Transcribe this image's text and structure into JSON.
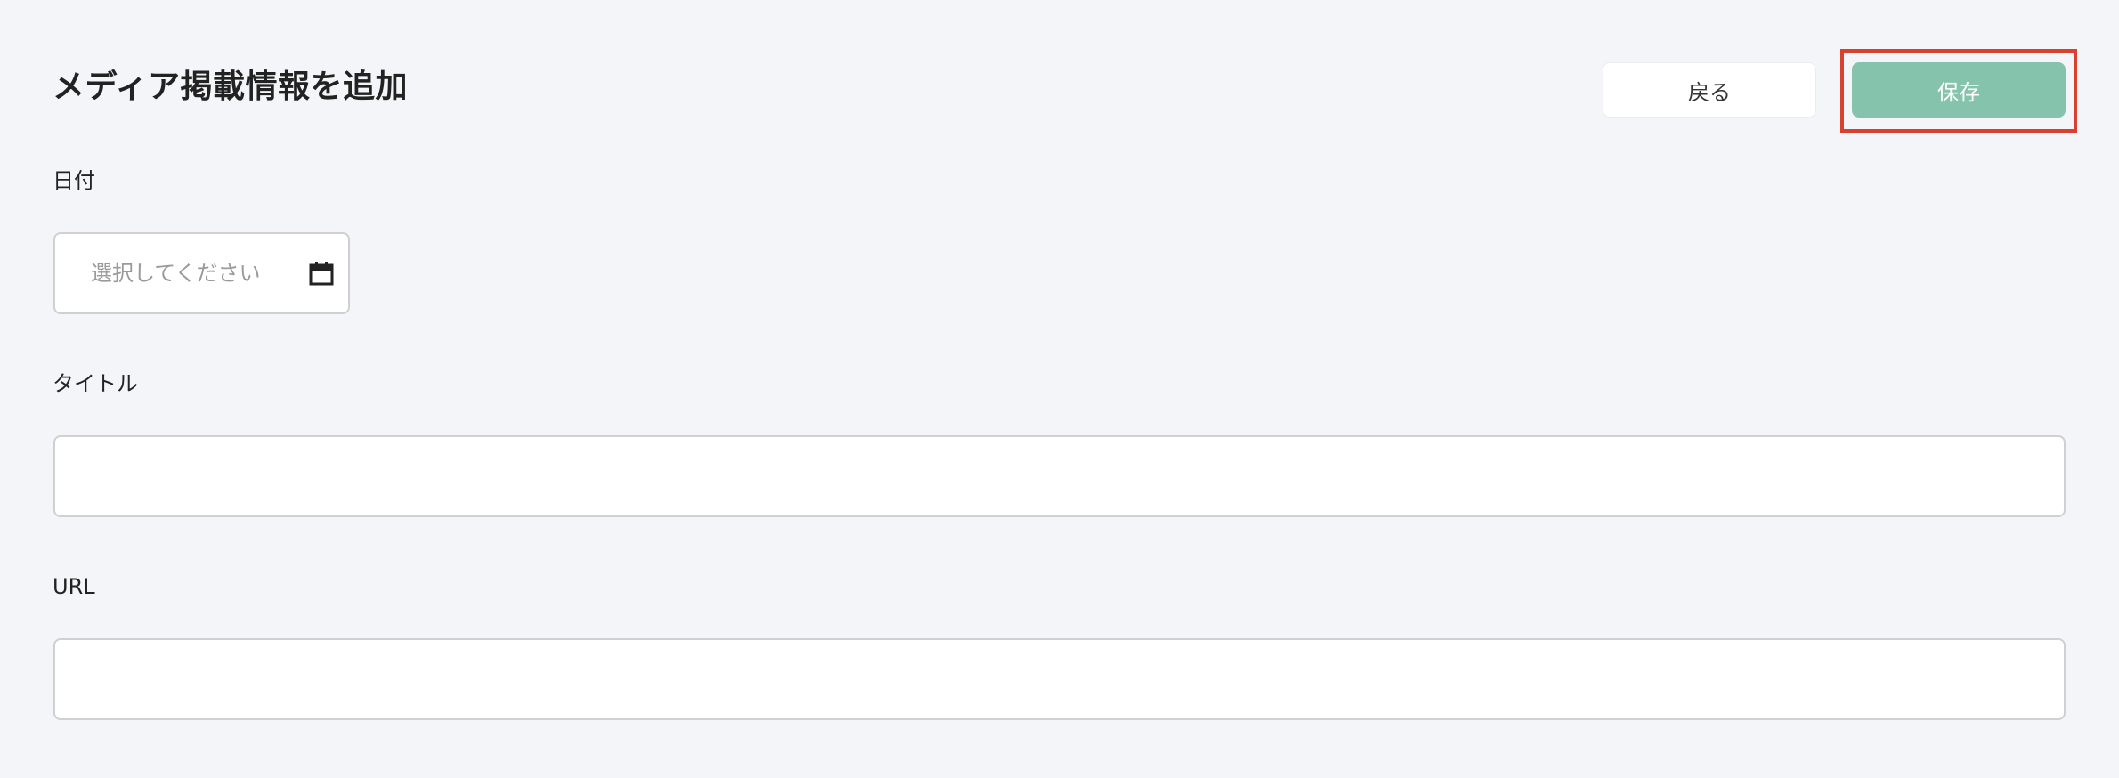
{
  "header": {
    "title": "メディア掲載情報を追加",
    "back_label": "戻る",
    "save_label": "保存"
  },
  "form": {
    "date": {
      "label": "日付",
      "placeholder": "選択してください",
      "icon": "calendar-icon"
    },
    "title": {
      "label": "タイトル",
      "value": ""
    },
    "url": {
      "label": "URL",
      "value": ""
    }
  },
  "colors": {
    "save_button": "#85c3ad",
    "highlight": "#d8412f",
    "background": "#f4f5f8"
  }
}
